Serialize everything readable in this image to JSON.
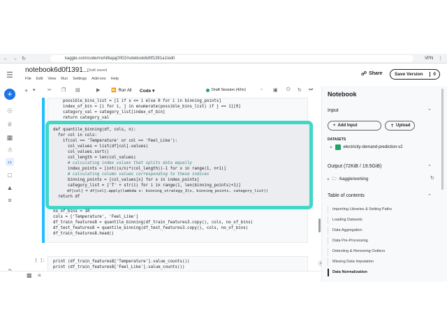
{
  "browser": {
    "url": "kaggle.com/code/mohitbajaj2002/notebook6d0f1391a1/edit",
    "vpn_label": "VPN"
  },
  "header": {
    "title": "notebook6d0f1391...",
    "status": "Draft saved",
    "menu": [
      "File",
      "Edit",
      "View",
      "Run",
      "Settings",
      "Add-ons",
      "Help"
    ],
    "share_label": "Share",
    "save_label": "Save Version",
    "save_count": "0"
  },
  "toolbar": {
    "run_all_label": "Run All",
    "cell_type": "Code",
    "session_label": "Draft Session (42m)"
  },
  "cells": {
    "cell1_lines_top": [
      "    possible_bins_list = [1 if x <= i else 0 for i in binning_points]",
      "    index_of_bin = [i for i, j in enumerate(possible_bins_list) if j == 1][0]",
      "    category_val = category_list[index_of_bin]",
      "    return category_val"
    ],
    "cell1_lines_highlight": [
      "def quantile_binning(df, cols, n):",
      "  for col in cols:",
      "    if(col == 'Temperature' or col == 'Feel_Like'):",
      "      col_values = list(df[col].values)",
      "      col_values.sort()",
      "      col_length = len(col_values)",
      "      # calculating index values that splits data equally",
      "      index_points = [int((x/n)*(col_length))-1 for x in range(1, n+1)]",
      "      # calculating column values corresponding to these indices",
      "      binning_points = [col_values[x] for x in index_points]",
      "      category_list = ['T' + str(i) for i in range(1, len(binning_points)+1)]",
      "      df[col] = df[col].apply(lambda x: binning_strategy_3(x, binning_points, category_list))",
      "  return df"
    ],
    "cell1_lines_bottom": [
      "no_of_bins = 10",
      "cols = ['Temperature', 'Feel_Like']",
      "df_train_features8 = quantile_binning(df_train_features3.copy(), cols, no_of_bins)",
      "df_test_features8 = quantile_binning(df_test_features3.copy(), cols, no_of_bins)",
      "df_train_features8.head()"
    ],
    "cell2_prompt": "[ ]:",
    "cell2_lines": [
      "print (df_train_features8['Temperature'].value_counts())",
      "print (df_train_features8['Feel_Like'].value_counts())"
    ]
  },
  "panel": {
    "title": "Notebook",
    "input_title": "Input",
    "add_input_label": "Add Input",
    "upload_label": "Upload",
    "datasets_label": "DATASETS",
    "dataset_name": "electricity-demand-prediction-v2",
    "output_title": "Output (72KiB / 19.5GiB)",
    "output_path": "/kaggle/working",
    "toc_title": "Table of contents",
    "toc": [
      "Importing Libraries & Setting Paths",
      "Loading Datasets",
      "Data Aggregation",
      "Data Pre-Processing",
      "Detecting & Removing Outliers",
      "Missing Data Imputation",
      "Data Normalization"
    ]
  },
  "icons": [
    "menu-icon",
    "kaggle-logo",
    "plus-icon",
    "compass-icon",
    "trophy-icon",
    "table-icon",
    "code-icon",
    "comment-icon",
    "school-icon",
    "help-icon",
    "scissors-icon",
    "copy-icon",
    "paste-icon",
    "play-icon",
    "power-icon",
    "refresh-icon",
    "fast-forward-icon",
    "more-icon",
    "share-icon"
  ],
  "colors": {
    "accent": "#20beff",
    "highlight_border": "#3fd8c8",
    "primary_blue": "#1a73e8",
    "session_green": "#20a464"
  }
}
